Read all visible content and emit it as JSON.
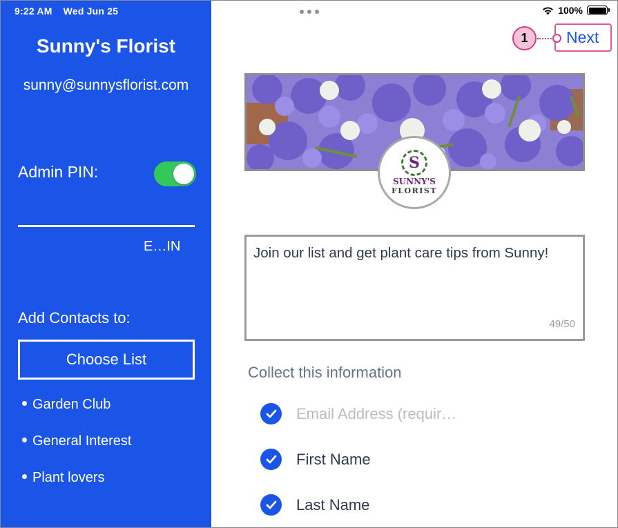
{
  "status_bar": {
    "time": "9:22 AM",
    "date": "Wed Jun 25",
    "battery": "100%",
    "icons": [
      "wifi-icon",
      "battery-icon"
    ]
  },
  "sidebar": {
    "store_name": "Sunny's Florist",
    "email": "sunny@sunnysflorist.com",
    "admin_pin_label": "Admin PIN:",
    "admin_pin_enabled": true,
    "pin_button_label": "E…IN",
    "add_contacts_label": "Add Contacts to:",
    "choose_list_label": "Choose List",
    "lists": [
      "Garden Club",
      "General Interest",
      "Plant lovers"
    ]
  },
  "header": {
    "callout_number": "1",
    "next_label": "Next"
  },
  "form": {
    "logo_line1": "SUNNY'S",
    "logo_line2": "FLORIST",
    "logo_monogram": "S",
    "message": "Join our list and get plant care tips from Sunny!",
    "char_count": "49/50",
    "collect_title": "Collect this information",
    "fields": [
      {
        "label": "Email Address (requir…",
        "checked": true,
        "locked": true
      },
      {
        "label": "First Name",
        "checked": true,
        "locked": false
      },
      {
        "label": "Last Name",
        "checked": true,
        "locked": false
      }
    ]
  },
  "colors": {
    "sidebar_bg": "#1a55e8",
    "toggle_on": "#34c759",
    "accent": "#1a55e8",
    "callout": "#d63d84"
  }
}
